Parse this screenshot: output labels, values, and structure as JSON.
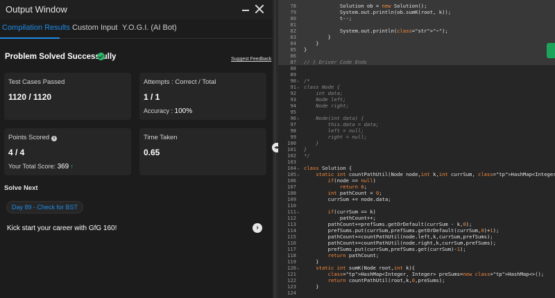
{
  "window": {
    "title": "Output Window"
  },
  "tabs": [
    {
      "label": "Compilation Results",
      "active": true
    },
    {
      "label": "Custom Input",
      "active": false
    },
    {
      "label": "Y.O.G.I. (AI Bot)",
      "active": false
    }
  ],
  "result": {
    "status": "Problem Solved Successfully",
    "feedback_link": "Suggest Feedback"
  },
  "cards": {
    "test_cases": {
      "label": "Test Cases Passed",
      "value": "1120 / 1120"
    },
    "attempts": {
      "label": "Attempts : Correct / Total",
      "value": "1 / 1",
      "sub_label": "Accuracy :",
      "sub_value": "100%"
    },
    "points": {
      "label": "Points Scored",
      "value": "4 / 4",
      "sub_label": "Your Total Score:",
      "sub_value": "369"
    },
    "time": {
      "label": "Time Taken",
      "value": "0.65"
    }
  },
  "solve_next": {
    "heading": "Solve Next",
    "problem": "Day 89 - Check for BST",
    "promo": "Kick start your career with GfG 160!"
  },
  "colors": {
    "accent": "#1f8ce6",
    "success": "#2fb36b",
    "keyword": "#fb8c3c"
  },
  "editor": {
    "lines": [
      {
        "n": "78",
        "code": "            Solution ob = new Solution();"
      },
      {
        "n": "79",
        "code": "            System.out.println(ob.sumK(root, k));"
      },
      {
        "n": "80",
        "code": "            t--;"
      },
      {
        "n": "81",
        "code": ""
      },
      {
        "n": "82",
        "code": "            System.out.println(\"~\");"
      },
      {
        "n": "83",
        "code": "        }"
      },
      {
        "n": "84",
        "code": "    }"
      },
      {
        "n": "85",
        "code": "}"
      },
      {
        "n": "86",
        "code": ""
      },
      {
        "n": "87",
        "code": "// } Driver Code Ends"
      },
      {
        "n": "88",
        "code": ""
      },
      {
        "n": "89",
        "code": ""
      },
      {
        "n": "90",
        "code": "/*"
      },
      {
        "n": "91",
        "code": "class Node {"
      },
      {
        "n": "92",
        "code": "    int data;"
      },
      {
        "n": "93",
        "code": "    Node left;"
      },
      {
        "n": "94",
        "code": "    Node right;"
      },
      {
        "n": "95",
        "code": ""
      },
      {
        "n": "96",
        "code": "    Node(int data) {"
      },
      {
        "n": "97",
        "code": "        this.data = data;"
      },
      {
        "n": "98",
        "code": "        left = null;"
      },
      {
        "n": "99",
        "code": "        right = null;"
      },
      {
        "n": "100",
        "code": "    }"
      },
      {
        "n": "101",
        "code": "}"
      },
      {
        "n": "102",
        "code": "*/"
      },
      {
        "n": "103",
        "code": ""
      },
      {
        "n": "104",
        "code": "class Solution {"
      },
      {
        "n": "105",
        "code": "    static int countPathUtil(Node node,int k,int currSum, HashMap<Integer,Integer>"
      },
      {
        "n": "106",
        "code": "        if(node == null)"
      },
      {
        "n": "107",
        "code": "            return 0;"
      },
      {
        "n": "108",
        "code": "        int pathCount = 0;"
      },
      {
        "n": "109",
        "code": "        currSum += node.data;"
      },
      {
        "n": "110",
        "code": ""
      },
      {
        "n": "111",
        "code": "        if(currSum == k)"
      },
      {
        "n": "112",
        "code": "            pathCount++;"
      },
      {
        "n": "113",
        "code": "        pathCount+=prefSums.getOrDefault(currSum - k,0);"
      },
      {
        "n": "114",
        "code": "        prefSums.put(currSum,prefSums.getOrDefault(currSum,0)+1);"
      },
      {
        "n": "115",
        "code": "        pathCount+=countPathUtil(node.left,k,currSum,prefSums);"
      },
      {
        "n": "116",
        "code": "        pathCount+=countPathUtil(node.right,k,currSum,prefSums);"
      },
      {
        "n": "117",
        "code": "        prefSums.put(currSum,prefSums.get(currSum)-1);"
      },
      {
        "n": "118",
        "code": "        return pathCount;"
      },
      {
        "n": "119",
        "code": "    }"
      },
      {
        "n": "120",
        "code": "    static int sumK(Node root,int k){"
      },
      {
        "n": "121",
        "code": "        HashMap<Integer, Integer> preSums=new HashMap<>();"
      },
      {
        "n": "122",
        "code": "        return countPathUtil(root,k,0,preSums);"
      },
      {
        "n": "123",
        "code": "    }"
      },
      {
        "n": "124",
        "code": ""
      }
    ]
  }
}
